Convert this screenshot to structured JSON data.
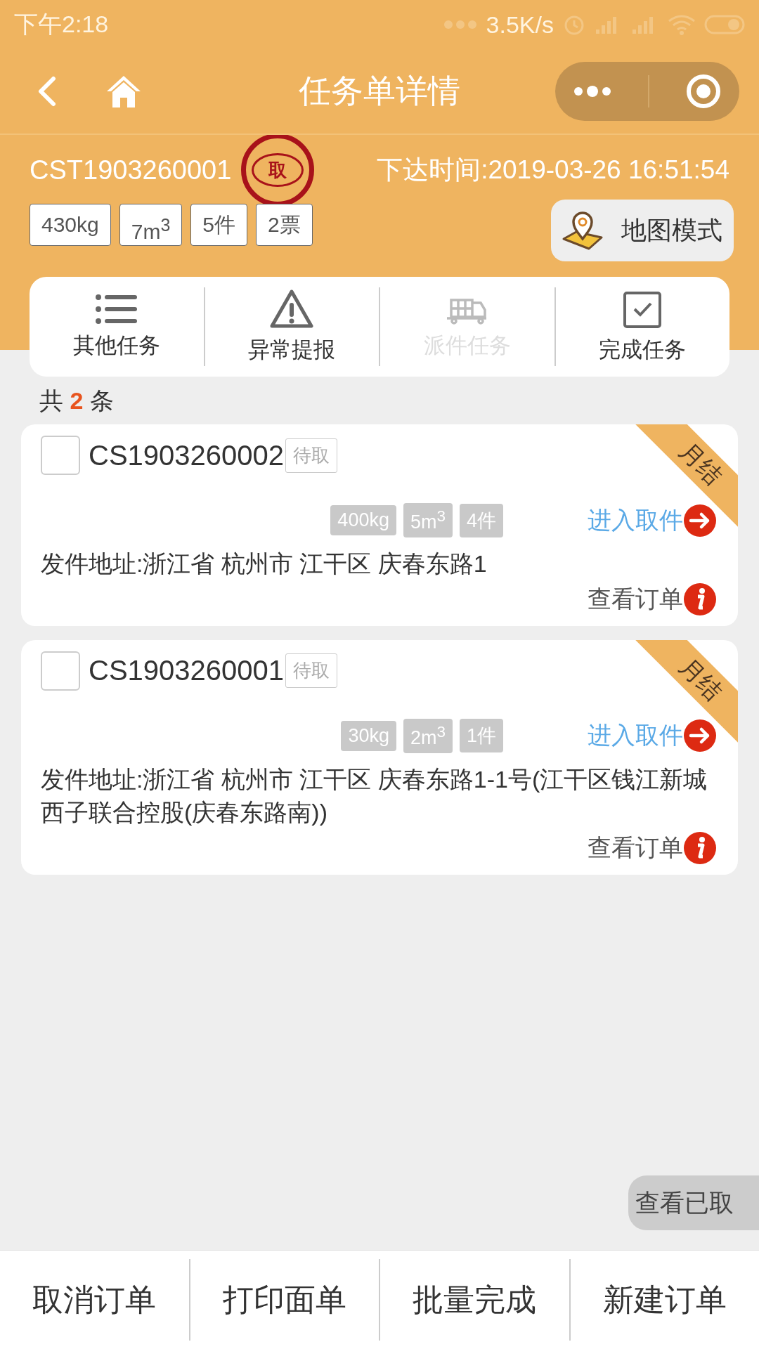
{
  "status_bar": {
    "time": "下午2:18",
    "speed": "3.5K/s"
  },
  "nav": {
    "title": "任务单详情"
  },
  "task": {
    "id": "CST1903260001",
    "stamp": "取",
    "issued": "下达时间:2019-03-26 16:51:54",
    "chips": [
      "430kg",
      "7m$^{3}$",
      "5件",
      "2票"
    ],
    "map_button": "地图模式"
  },
  "actions": [
    {
      "kind": "list",
      "label": "其他任务",
      "disabled": false
    },
    {
      "kind": "warning",
      "label": "异常提报",
      "disabled": false
    },
    {
      "kind": "truck",
      "label": "派件任务",
      "disabled": true
    },
    {
      "kind": "check",
      "label": "完成任务",
      "disabled": false
    }
  ],
  "count": {
    "prefix": "共",
    "value": "2",
    "suffix": "条"
  },
  "orders": [
    {
      "id": "CS1903260002",
      "checked": false,
      "status": "待取",
      "ribbon": "月结",
      "chips": [
        "400kg",
        "5m$^{3}$",
        "4件"
      ],
      "pickup_link": "进入取件",
      "address": "发件地址:浙江省 杭州市 江干区 庆春东路1",
      "view_link": "查看订单"
    },
    {
      "id": "CS1903260001",
      "checked": false,
      "status": "待取",
      "ribbon": "月结",
      "chips": [
        "30kg",
        "2m$^{3}$",
        "1件"
      ],
      "pickup_link": "进入取件",
      "address": "发件地址:浙江省 杭州市 江干区 庆春东路1-1号(江干区钱江新城西子联合控股(庆春东路南))",
      "view_link": "查看订单"
    }
  ],
  "floating_button": "查看已取",
  "bottom_buttons": [
    "取消订单",
    "打印面单",
    "批量完成",
    "新建订单"
  ]
}
